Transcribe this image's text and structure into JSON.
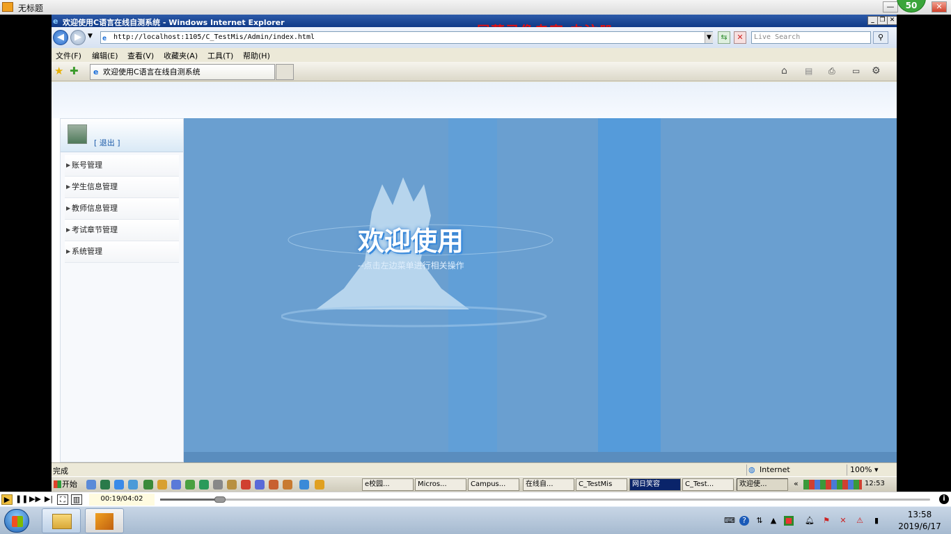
{
  "player": {
    "title": "无标题",
    "badge": "50",
    "min": "—",
    "close": "✕",
    "time": "00:19/04:02",
    "progress": 0.078
  },
  "ie": {
    "title": "欢迎使用C语言在线自测系统 - Windows Internet Explorer",
    "watermark": "屏幕录像专家  未注册",
    "address": "http://localhost:1105/C_TestMis/Admin/index.html",
    "search_placeholder": "Live Search",
    "menus": [
      "文件(F)",
      "编辑(E)",
      "查看(V)",
      "收藏夹(A)",
      "工具(T)",
      "帮助(H)"
    ],
    "tab_label": "欢迎使用C语言在线自测系统",
    "status": "完成",
    "zone": "Internet",
    "zoom": "100%"
  },
  "page": {
    "logout": "[ 退出 ]",
    "menu": [
      "账号管理",
      "学生信息管理",
      "教师信息管理",
      "考试章节管理",
      "系统管理"
    ],
    "welcome": "欢迎使用",
    "subtitle": "--点击左边菜单进行相关操作"
  },
  "inner_taskbar": {
    "start": "开始",
    "tasks": [
      "e校园...",
      "Micros...",
      "Campus...",
      "在线自...",
      "C_TestMis",
      "网日笑容",
      "C_Test...",
      "欢迎使..."
    ],
    "active_index": 7,
    "clock": "12:53"
  },
  "taskbar": {
    "time": "13:58",
    "date": "2019/6/17"
  },
  "colors": {
    "watermark": "#e01010",
    "content_bg": "#6a9fd0",
    "ie_title": "#0f3a88"
  }
}
